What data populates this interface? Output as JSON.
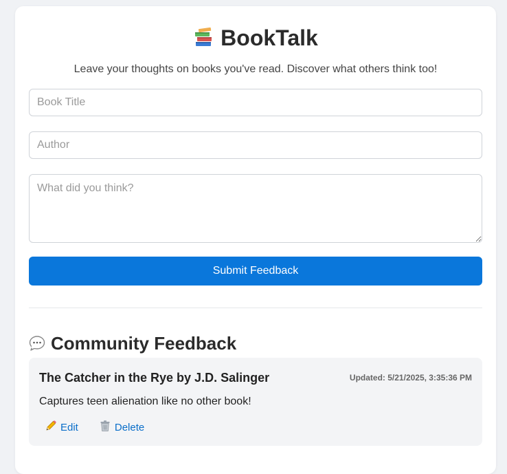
{
  "app": {
    "title": "BookTalk",
    "logo_icon": "books-icon",
    "tagline": "Leave your thoughts on books you've read. Discover what others think too!"
  },
  "form": {
    "title_placeholder": "Book Title",
    "author_placeholder": "Author",
    "thoughts_placeholder": "What did you think?",
    "submit_label": "Submit Feedback"
  },
  "feedback_section": {
    "icon": "speech-bubble-icon",
    "heading": "Community Feedback",
    "items": [
      {
        "title": "The Catcher in the Rye by J.D. Salinger",
        "updated": "Updated: 5/21/2025, 3:35:36 PM",
        "text": "Captures teen alienation like no other book!",
        "edit_label": "Edit",
        "edit_icon": "pencil-icon",
        "delete_label": "Delete",
        "delete_icon": "trash-icon"
      }
    ]
  },
  "colors": {
    "accent": "#0a77db",
    "link": "#0a6ec9",
    "card_bg": "#f3f4f6",
    "page_bg": "#f0f2f5"
  }
}
